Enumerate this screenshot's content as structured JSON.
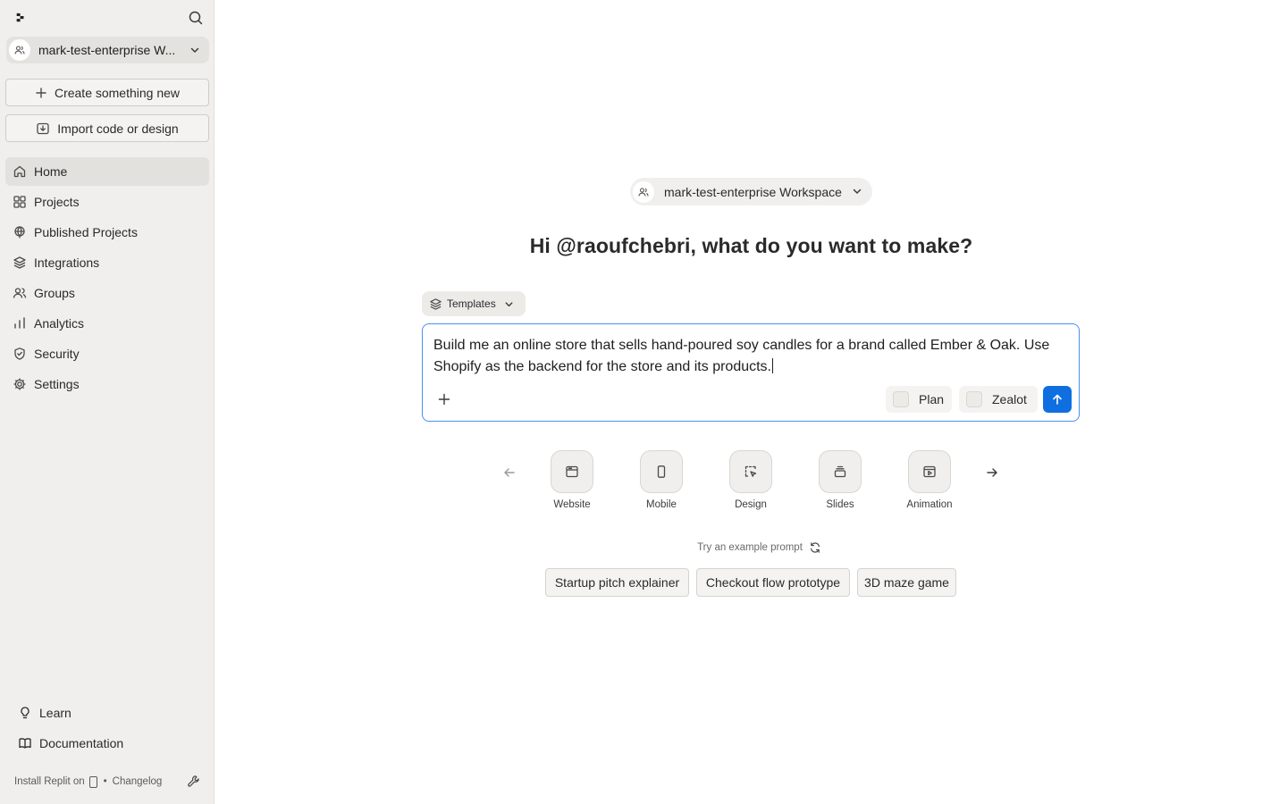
{
  "sidebar": {
    "workspace": "mark-test-enterprise W...",
    "create_label": "Create something new",
    "import_label": "Import code or design",
    "nav": [
      {
        "label": "Home",
        "icon": "home-icon",
        "active": true
      },
      {
        "label": "Projects",
        "icon": "grid-icon"
      },
      {
        "label": "Published Projects",
        "icon": "globe-icon"
      },
      {
        "label": "Integrations",
        "icon": "layers-icon"
      },
      {
        "label": "Groups",
        "icon": "users-icon"
      },
      {
        "label": "Analytics",
        "icon": "bar-chart-icon"
      },
      {
        "label": "Security",
        "icon": "shield-icon"
      },
      {
        "label": "Settings",
        "icon": "gear-icon"
      }
    ],
    "learn": "Learn",
    "documentation": "Documentation",
    "footer": {
      "install": "Install Replit on",
      "separator": "•",
      "changelog": "Changelog"
    }
  },
  "main": {
    "workspace_pill": "mark-test-enterprise Workspace",
    "headline": "Hi @raoufchebri, what do you want to make?",
    "templates_label": "Templates",
    "prompt": "Build me an online store that sells hand-poured soy candles for a brand called Ember & Oak. Use Shopify as the backend for the store and its products.",
    "toggles": {
      "plan": "Plan",
      "zealot": "Zealot"
    },
    "types": [
      {
        "label": "Website",
        "icon": "browser-window-icon"
      },
      {
        "label": "Mobile",
        "icon": "phone-icon"
      },
      {
        "label": "Design",
        "icon": "design-select-icon"
      },
      {
        "label": "Slides",
        "icon": "slides-stack-icon"
      },
      {
        "label": "Animation",
        "icon": "animation-play-icon"
      }
    ],
    "try_label": "Try an example prompt",
    "examples": [
      "Startup pitch explainer",
      "Checkout flow prototype",
      "3D maze game"
    ]
  },
  "colors": {
    "sidebar_bg": "#f0efed",
    "accent": "#0f6fe0",
    "focus_border": "#4b8ef2"
  }
}
